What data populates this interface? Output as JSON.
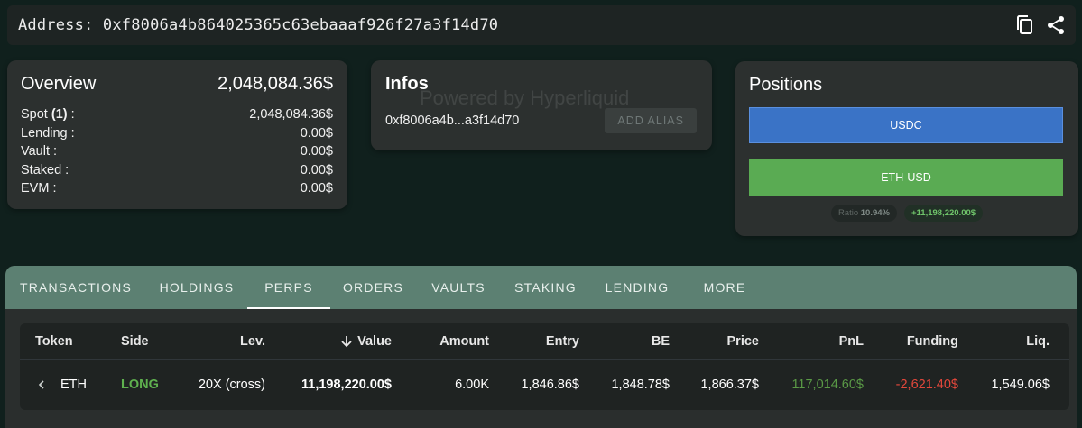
{
  "address_bar": {
    "label": "Address:",
    "address": "0xf8006a4b864025365c63ebaaaf926f27a3f14d70",
    "icons": [
      "copy-icon",
      "share-icon"
    ]
  },
  "overview": {
    "title": "Overview",
    "total": "2,048,084.36$",
    "rows": [
      {
        "label": "Spot",
        "count": "(1)",
        "suffix": " :",
        "value": "2,048,084.36$"
      },
      {
        "label": "Lending :",
        "value": "0.00$"
      },
      {
        "label": "Vault :",
        "value": "0.00$"
      },
      {
        "label": "Staked :",
        "value": "0.00$"
      },
      {
        "label": "EVM :",
        "value": "0.00$"
      }
    ]
  },
  "infos": {
    "title": "Infos",
    "short_address": "0xf8006a4b...a3f14d70",
    "add_alias_label": "ADD ALIAS"
  },
  "positions": {
    "title": "Positions",
    "bars": [
      {
        "label": "USDC",
        "color": "#3a73c6"
      },
      {
        "label": "ETH-USD",
        "color": "#5aab53"
      }
    ],
    "ratio_label": "Ratio",
    "ratio_value": "10.94%",
    "pnl_value": "+11,198,220.00$"
  },
  "tabs": {
    "items": [
      "TRANSACTIONS",
      "HOLDINGS",
      "PERPS",
      "ORDERS",
      "VAULTS",
      "STAKING",
      "LENDING",
      "MORE"
    ],
    "active": "PERPS"
  },
  "perps_table": {
    "columns": [
      "Token",
      "Side",
      "Lev.",
      "Value",
      "Amount",
      "Entry",
      "BE",
      "Price",
      "PnL",
      "Funding",
      "Liq."
    ],
    "sort_column": "Value",
    "sort_direction": "descending",
    "rows": [
      {
        "token": "ETH",
        "side": "LONG",
        "lev": "20X (cross)",
        "value": "11,198,220.00$",
        "amount": "6.00K",
        "entry": "1,846.86$",
        "be": "1,848.78$",
        "price": "1,866.37$",
        "pnl": "117,014.60$",
        "funding": "-2,621.40$",
        "liq": "1,549.06$"
      }
    ],
    "watermark": "Powered by Hyperliquid"
  },
  "colors": {
    "background": "#10201d",
    "card": "#2c302f",
    "tab_bar": "#5c8072",
    "positive": "#5a9a46",
    "negative": "#e2473b"
  }
}
